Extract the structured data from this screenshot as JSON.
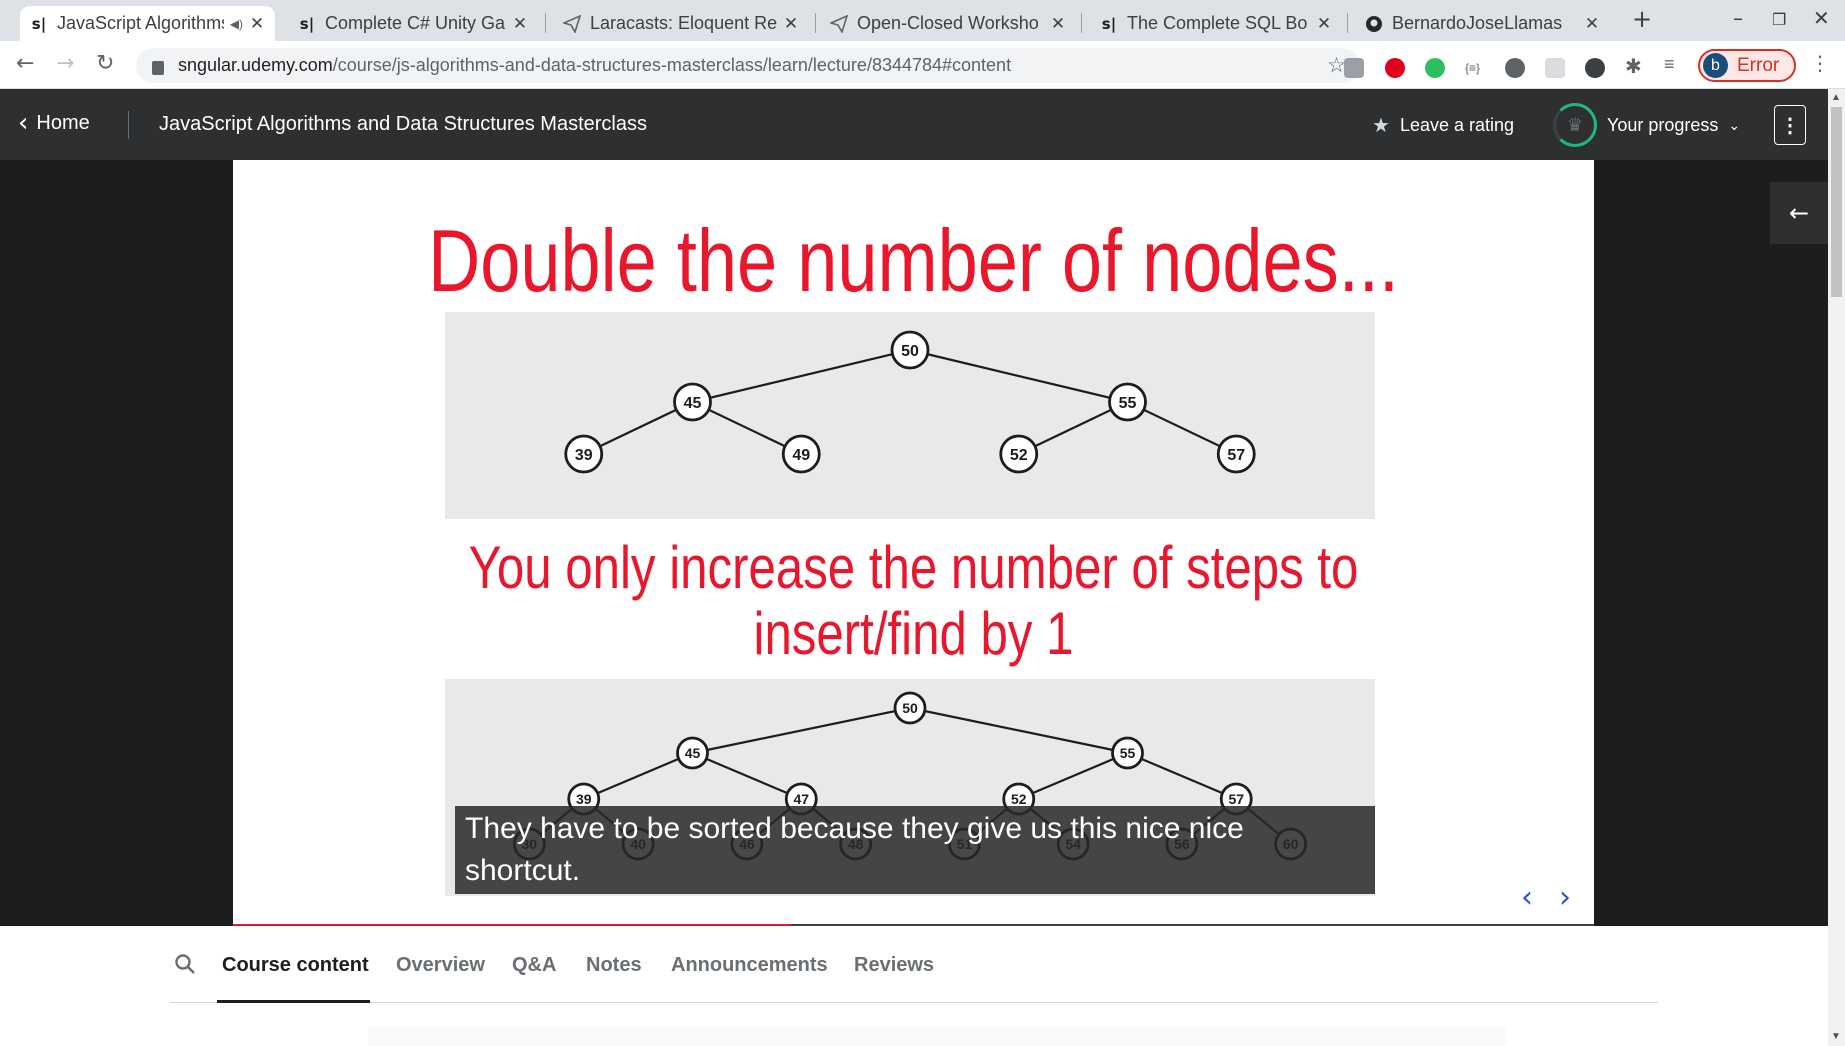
{
  "browser": {
    "tabs": [
      {
        "favicon": "s|",
        "title": "JavaScript Algorithms",
        "active": true
      },
      {
        "favicon": "s|",
        "title": "Complete C# Unity Game",
        "active": false
      },
      {
        "favicon": "plane-icon",
        "title": "Laracasts: Eloquent Re",
        "active": false
      },
      {
        "favicon": "plane-icon",
        "title": "Open-Closed Worksho",
        "active": false
      },
      {
        "favicon": "s|",
        "title": "The Complete SQL Bo",
        "active": false
      },
      {
        "favicon": "github-icon",
        "title": "BernardoJoseLlamas",
        "active": false
      }
    ],
    "new_tab_label": "+",
    "url_host": "sngular.udemy.com",
    "url_path": "/course/js-algorithms-and-data-structures-masterclass/learn/lecture/8344784#content",
    "profile_initial": "b",
    "profile_status": "Error",
    "error_color": "#d93025"
  },
  "header": {
    "home_label": "Home",
    "course_title": "JavaScript Algorithms and Data Structures Masterclass",
    "rating_label": "Leave a rating",
    "progress_label": "Your progress"
  },
  "slide": {
    "heading": "Double the number of nodes...",
    "subheading_line1": "You only increase the number of steps to",
    "subheading_line2": "insert/find by 1",
    "accent_color": "#e8172c",
    "tree_small": {
      "nodes": [
        {
          "value": "50",
          "level": 0,
          "slot": 0
        },
        {
          "value": "45",
          "level": 1,
          "slot": 0
        },
        {
          "value": "55",
          "level": 1,
          "slot": 1
        },
        {
          "value": "39",
          "level": 2,
          "slot": 0
        },
        {
          "value": "49",
          "level": 2,
          "slot": 1
        },
        {
          "value": "52",
          "level": 2,
          "slot": 2
        },
        {
          "value": "57",
          "level": 2,
          "slot": 3
        }
      ],
      "edges": [
        [
          "50",
          "45"
        ],
        [
          "50",
          "55"
        ],
        [
          "45",
          "39"
        ],
        [
          "45",
          "49"
        ],
        [
          "55",
          "52"
        ],
        [
          "55",
          "57"
        ]
      ]
    },
    "tree_large": {
      "nodes": [
        {
          "value": "50",
          "level": 0,
          "slot": 0
        },
        {
          "value": "45",
          "level": 1,
          "slot": 0
        },
        {
          "value": "55",
          "level": 1,
          "slot": 1
        },
        {
          "value": "39",
          "level": 2,
          "slot": 0
        },
        {
          "value": "47",
          "level": 2,
          "slot": 1
        },
        {
          "value": "52",
          "level": 2,
          "slot": 2
        },
        {
          "value": "57",
          "level": 2,
          "slot": 3
        },
        {
          "value": "30",
          "level": 3,
          "slot": 0
        },
        {
          "value": "40",
          "level": 3,
          "slot": 1
        },
        {
          "value": "46",
          "level": 3,
          "slot": 2
        },
        {
          "value": "48",
          "level": 3,
          "slot": 3
        },
        {
          "value": "51",
          "level": 3,
          "slot": 4
        },
        {
          "value": "54",
          "level": 3,
          "slot": 5
        },
        {
          "value": "56",
          "level": 3,
          "slot": 6
        },
        {
          "value": "60",
          "level": 3,
          "slot": 7
        }
      ],
      "edges": [
        [
          "50",
          "45"
        ],
        [
          "50",
          "55"
        ],
        [
          "45",
          "39"
        ],
        [
          "45",
          "47"
        ],
        [
          "55",
          "52"
        ],
        [
          "55",
          "57"
        ],
        [
          "39",
          "30"
        ],
        [
          "39",
          "40"
        ],
        [
          "47",
          "46"
        ],
        [
          "47",
          "48"
        ],
        [
          "52",
          "51"
        ],
        [
          "52",
          "54"
        ],
        [
          "57",
          "56"
        ],
        [
          "57",
          "60"
        ]
      ]
    },
    "caption": "They have to be sorted because they give us this nice nice shortcut.",
    "playback_progress": 0.41
  },
  "course_tabs": [
    {
      "label": "Course content",
      "active": true
    },
    {
      "label": "Overview",
      "active": false
    },
    {
      "label": "Q&A",
      "active": false
    },
    {
      "label": "Notes",
      "active": false
    },
    {
      "label": "Announcements",
      "active": false
    },
    {
      "label": "Reviews",
      "active": false
    }
  ]
}
